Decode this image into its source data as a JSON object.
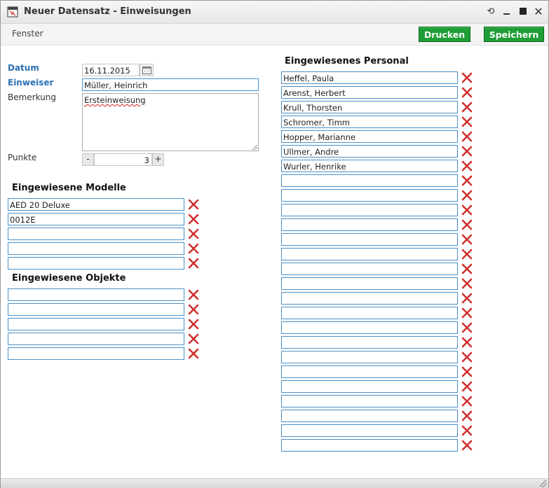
{
  "window": {
    "title": "Neuer Datensatz - Einweisungen"
  },
  "toolbar": {
    "menu_fenster": "Fenster",
    "print_label": "Drucken",
    "save_label": "Speichern",
    "accent": "#1f9d36"
  },
  "form": {
    "datum_label": "Datum",
    "datum_value": "16.11.2015",
    "einweiser_label": "Einweiser",
    "einweiser_value": "Müller, Heinrich",
    "bemerkung_label": "Bemerkung",
    "bemerkung_value": "Ersteinweisung",
    "punkte_label": "Punkte",
    "punkte_value": "3",
    "minus": "-",
    "plus": "+"
  },
  "modelle": {
    "heading": "Eingewiesene Modelle",
    "items": [
      "AED 20 Deluxe",
      "0012E",
      "",
      "",
      ""
    ]
  },
  "objekte": {
    "heading": "Eingewiesene Objekte",
    "items": [
      "",
      "",
      "",
      "",
      ""
    ]
  },
  "personal": {
    "heading": "Eingewiesenes Personal",
    "items": [
      "Heffel, Paula",
      "Arenst, Herbert",
      "Krull, Thorsten",
      "Schromer, Timm",
      "Hopper, Marianne",
      "Ullmer, Andre",
      "Wurler, Henrike",
      "",
      "",
      "",
      "",
      "",
      "",
      "",
      "",
      "",
      "",
      "",
      "",
      "",
      "",
      "",
      "",
      "",
      "",
      ""
    ]
  },
  "icons": {
    "app": "app-window-icon",
    "delete": "delete-x-icon",
    "calendar": "calendar-icon"
  }
}
